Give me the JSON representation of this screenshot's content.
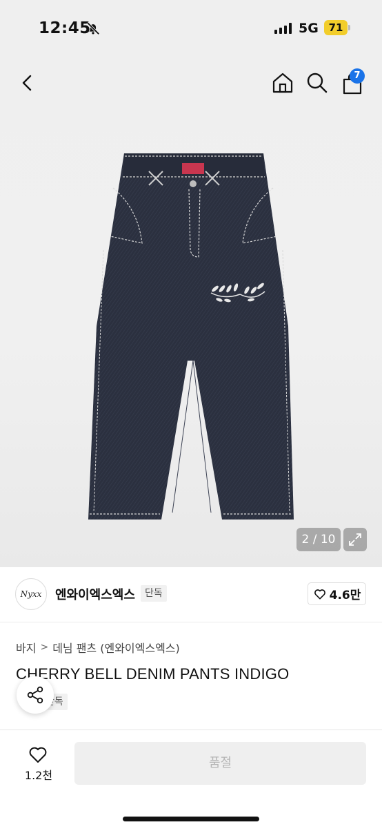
{
  "status_bar": {
    "time": "12:45",
    "network": "5G",
    "battery": "71"
  },
  "header": {
    "cart_count": "7"
  },
  "gallery": {
    "counter": "2 / 10",
    "current_image": 2,
    "total_images": 10
  },
  "brand": {
    "logo_text": "Nyxx",
    "name": "엔와이엑스엑스",
    "tag": "단독",
    "likes": "4.6만"
  },
  "product": {
    "breadcrumb": [
      "바지",
      "데님 팬츠 (엔와이엑스엑스)"
    ],
    "breadcrumb_separator": ">",
    "title": "CHERRY BELL DENIM PANTS INDIGO",
    "exclusive_tag": "단독"
  },
  "bottom_bar": {
    "wish_count": "1.2천",
    "buy_button": "품절"
  },
  "colors": {
    "accent_badge": "#1a73e8",
    "battery": "#f2cd2a",
    "denim": "#2a2f3d"
  }
}
